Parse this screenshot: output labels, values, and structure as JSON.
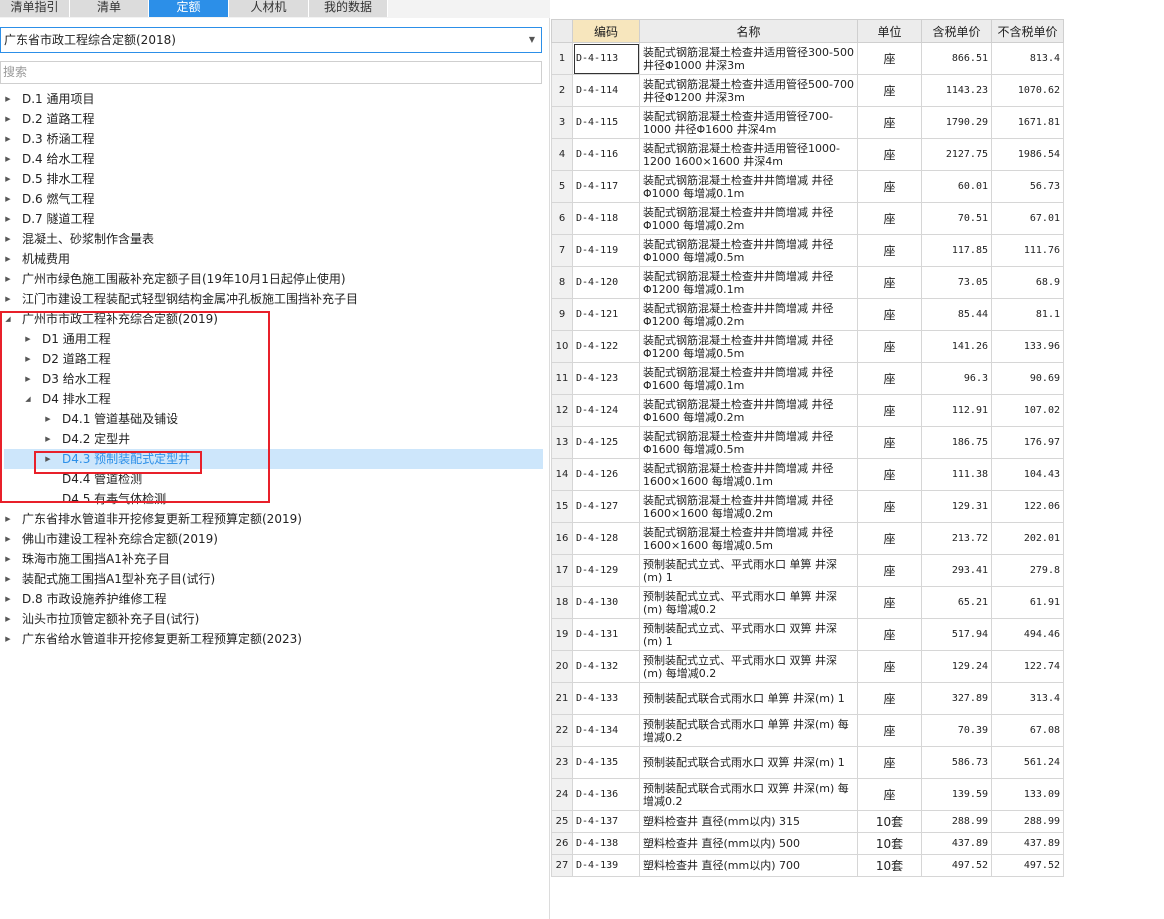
{
  "tabs": [
    {
      "label": "清单指引",
      "active": false
    },
    {
      "label": "清单",
      "active": false
    },
    {
      "label": "定额",
      "active": true
    },
    {
      "label": "人材机",
      "active": false
    },
    {
      "label": "我的数据",
      "active": false
    }
  ],
  "select": {
    "value": "广东省市政工程综合定额(2018)"
  },
  "search": {
    "placeholder": "搜索"
  },
  "tree": [
    {
      "label": "D.1 通用项目",
      "level": 0,
      "expander": "collapsed"
    },
    {
      "label": "D.2 道路工程",
      "level": 0,
      "expander": "collapsed"
    },
    {
      "label": "D.3 桥涵工程",
      "level": 0,
      "expander": "collapsed"
    },
    {
      "label": "D.4 给水工程",
      "level": 0,
      "expander": "collapsed"
    },
    {
      "label": "D.5 排水工程",
      "level": 0,
      "expander": "collapsed"
    },
    {
      "label": "D.6 燃气工程",
      "level": 0,
      "expander": "collapsed"
    },
    {
      "label": "D.7 隧道工程",
      "level": 0,
      "expander": "collapsed"
    },
    {
      "label": "混凝土、砂浆制作含量表",
      "level": 0,
      "expander": "collapsed"
    },
    {
      "label": "机械费用",
      "level": 0,
      "expander": "collapsed"
    },
    {
      "label": "广州市绿色施工围蔽补充定额子目(19年10月1日起停止使用)",
      "level": 0,
      "expander": "collapsed"
    },
    {
      "label": "江门市建设工程装配式轻型钢结构金属冲孔板施工围挡补充子目",
      "level": 0,
      "expander": "collapsed"
    },
    {
      "label": "广州市市政工程补充综合定额(2019)",
      "level": 0,
      "expander": "expanded"
    },
    {
      "label": "D1 通用工程",
      "level": 1,
      "expander": "collapsed"
    },
    {
      "label": "D2 道路工程",
      "level": 1,
      "expander": "collapsed"
    },
    {
      "label": "D3 给水工程",
      "level": 1,
      "expander": "collapsed"
    },
    {
      "label": "D4 排水工程",
      "level": 1,
      "expander": "expanded"
    },
    {
      "label": "D4.1 管道基础及铺设",
      "level": 2,
      "expander": "collapsed"
    },
    {
      "label": "D4.2 定型井",
      "level": 2,
      "expander": "collapsed"
    },
    {
      "label": "D4.3 预制装配式定型井",
      "level": 2,
      "expander": "collapsed",
      "selected": true
    },
    {
      "label": "D4.4 管道检测",
      "level": 2,
      "expander": "none"
    },
    {
      "label": "D4.5 有毒气体检测",
      "level": 2,
      "expander": "none"
    },
    {
      "label": "广东省排水管道非开挖修复更新工程预算定额(2019)",
      "level": 0,
      "expander": "collapsed"
    },
    {
      "label": "佛山市建设工程补充综合定额(2019)",
      "level": 0,
      "expander": "collapsed"
    },
    {
      "label": "珠海市施工围挡A1补充子目",
      "level": 0,
      "expander": "collapsed"
    },
    {
      "label": "装配式施工围挡A1型补充子目(试行)",
      "level": 0,
      "expander": "collapsed"
    },
    {
      "label": "D.8 市政设施养护维修工程",
      "level": 0,
      "expander": "collapsed"
    },
    {
      "label": "汕头市拉顶管定额补充子目(试行)",
      "level": 0,
      "expander": "collapsed"
    },
    {
      "label": "广东省给水管道非开挖修复更新工程预算定额(2023)",
      "level": 0,
      "expander": "collapsed"
    }
  ],
  "table": {
    "headers": [
      "编码",
      "名称",
      "单位",
      "含税单价",
      "不含税单价"
    ],
    "rows": [
      {
        "idx": "1",
        "code": "D-4-113",
        "name": "装配式钢筋混凝土检查井适用管径300-500 井径Φ1000 井深3m",
        "unit": "座",
        "tax": "866.51",
        "notax": "813.4"
      },
      {
        "idx": "2",
        "code": "D-4-114",
        "name": "装配式钢筋混凝土检查井适用管径500-700 井径Φ1200 井深3m",
        "unit": "座",
        "tax": "1143.23",
        "notax": "1070.62"
      },
      {
        "idx": "3",
        "code": "D-4-115",
        "name": "装配式钢筋混凝土检查井适用管径700-1000 井径Φ1600 井深4m",
        "unit": "座",
        "tax": "1790.29",
        "notax": "1671.81"
      },
      {
        "idx": "4",
        "code": "D-4-116",
        "name": "装配式钢筋混凝土检查井适用管径1000-1200 1600×1600 井深4m",
        "unit": "座",
        "tax": "2127.75",
        "notax": "1986.54"
      },
      {
        "idx": "5",
        "code": "D-4-117",
        "name": "装配式钢筋混凝土检查井井筒增减 井径Φ1000 每增减0.1m",
        "unit": "座",
        "tax": "60.01",
        "notax": "56.73"
      },
      {
        "idx": "6",
        "code": "D-4-118",
        "name": "装配式钢筋混凝土检查井井筒增减 井径Φ1000 每增减0.2m",
        "unit": "座",
        "tax": "70.51",
        "notax": "67.01"
      },
      {
        "idx": "7",
        "code": "D-4-119",
        "name": "装配式钢筋混凝土检查井井筒增减 井径Φ1000 每增减0.5m",
        "unit": "座",
        "tax": "117.85",
        "notax": "111.76"
      },
      {
        "idx": "8",
        "code": "D-4-120",
        "name": "装配式钢筋混凝土检查井井筒增减 井径Φ1200 每增减0.1m",
        "unit": "座",
        "tax": "73.05",
        "notax": "68.9"
      },
      {
        "idx": "9",
        "code": "D-4-121",
        "name": "装配式钢筋混凝土检查井井筒增减 井径Φ1200 每增减0.2m",
        "unit": "座",
        "tax": "85.44",
        "notax": "81.1"
      },
      {
        "idx": "10",
        "code": "D-4-122",
        "name": "装配式钢筋混凝土检查井井筒增减 井径Φ1200 每增减0.5m",
        "unit": "座",
        "tax": "141.26",
        "notax": "133.96"
      },
      {
        "idx": "11",
        "code": "D-4-123",
        "name": "装配式钢筋混凝土检查井井筒增减 井径Φ1600 每增减0.1m",
        "unit": "座",
        "tax": "96.3",
        "notax": "90.69"
      },
      {
        "idx": "12",
        "code": "D-4-124",
        "name": "装配式钢筋混凝土检查井井筒增减 井径Φ1600 每增减0.2m",
        "unit": "座",
        "tax": "112.91",
        "notax": "107.02"
      },
      {
        "idx": "13",
        "code": "D-4-125",
        "name": "装配式钢筋混凝土检查井井筒增减 井径Φ1600 每增减0.5m",
        "unit": "座",
        "tax": "186.75",
        "notax": "176.97"
      },
      {
        "idx": "14",
        "code": "D-4-126",
        "name": "装配式钢筋混凝土检查井井筒增减 井径1600×1600 每增减0.1m",
        "unit": "座",
        "tax": "111.38",
        "notax": "104.43"
      },
      {
        "idx": "15",
        "code": "D-4-127",
        "name": "装配式钢筋混凝土检查井井筒增减 井径1600×1600 每增减0.2m",
        "unit": "座",
        "tax": "129.31",
        "notax": "122.06"
      },
      {
        "idx": "16",
        "code": "D-4-128",
        "name": "装配式钢筋混凝土检查井井筒增减 井径1600×1600 每增减0.5m",
        "unit": "座",
        "tax": "213.72",
        "notax": "202.01"
      },
      {
        "idx": "17",
        "code": "D-4-129",
        "name": "预制装配式立式、平式雨水口 单箅 井深(m) 1",
        "unit": "座",
        "tax": "293.41",
        "notax": "279.8"
      },
      {
        "idx": "18",
        "code": "D-4-130",
        "name": "预制装配式立式、平式雨水口 单箅 井深(m) 每增减0.2",
        "unit": "座",
        "tax": "65.21",
        "notax": "61.91"
      },
      {
        "idx": "19",
        "code": "D-4-131",
        "name": "预制装配式立式、平式雨水口 双箅 井深(m) 1",
        "unit": "座",
        "tax": "517.94",
        "notax": "494.46"
      },
      {
        "idx": "20",
        "code": "D-4-132",
        "name": "预制装配式立式、平式雨水口 双箅 井深(m) 每增减0.2",
        "unit": "座",
        "tax": "129.24",
        "notax": "122.74"
      },
      {
        "idx": "21",
        "code": "D-4-133",
        "name": "预制装配式联合式雨水口 单箅 井深(m) 1",
        "unit": "座",
        "tax": "327.89",
        "notax": "313.4"
      },
      {
        "idx": "22",
        "code": "D-4-134",
        "name": "预制装配式联合式雨水口 单箅 井深(m) 每增减0.2",
        "unit": "座",
        "tax": "70.39",
        "notax": "67.08"
      },
      {
        "idx": "23",
        "code": "D-4-135",
        "name": "预制装配式联合式雨水口 双箅 井深(m) 1",
        "unit": "座",
        "tax": "586.73",
        "notax": "561.24"
      },
      {
        "idx": "24",
        "code": "D-4-136",
        "name": "预制装配式联合式雨水口 双箅 井深(m) 每增减0.2",
        "unit": "座",
        "tax": "139.59",
        "notax": "133.09"
      },
      {
        "idx": "25",
        "code": "D-4-137",
        "name": "塑料检查井 直径(mm以内) 315",
        "unit": "10套",
        "tax": "288.99",
        "notax": "288.99"
      },
      {
        "idx": "26",
        "code": "D-4-138",
        "name": "塑料检查井 直径(mm以内) 500",
        "unit": "10套",
        "tax": "437.89",
        "notax": "437.89"
      },
      {
        "idx": "27",
        "code": "D-4-139",
        "name": "塑料检查井 直径(mm以内) 700",
        "unit": "10套",
        "tax": "497.52",
        "notax": "497.52"
      }
    ]
  },
  "colors": {
    "accent": "#2c8fe8",
    "highlight_box": "#e8202a",
    "code_header": "#f7e6bd",
    "selected_row": "#cde6fb"
  }
}
